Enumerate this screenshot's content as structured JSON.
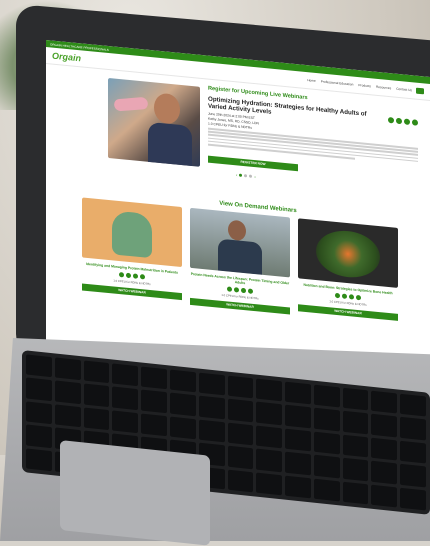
{
  "site": {
    "topbar_text": "ORGAIN HEALTHCARE PROFESSIONALS",
    "logo": "Orgain",
    "nav": [
      "Home",
      "Professional Education",
      "Products",
      "Resources",
      "Contact Us"
    ],
    "brand_color": "#2e8b18"
  },
  "hero": {
    "section_title": "Register for Upcoming Live Webinars",
    "title": "Optimizing Hydration: Strategies for Healthy Adults of Varied Activity Levels",
    "date": "June 20th 2024 at 2:00 PM EST",
    "presenter": "Kathy Jones, MS, RD, CSSD, LDN",
    "credits": "1.0 CPEU for RDNs & NDTRs",
    "button": "REGISTER NOW",
    "carousel_prev": "‹",
    "carousel_next": "›"
  },
  "on_demand": {
    "section_title": "View On Demand Webinars",
    "cards": [
      {
        "title": "Identifying and Managing Protein Malnutrition in Patients",
        "meta": "1.0 CPEU for RDNs & NDTRs",
        "button": "WATCH WEBINAR"
      },
      {
        "title": "Protein Needs Across the Lifespan: Protein Timing and Older Adults",
        "meta": "1.0 CPEU for RDNs & NDTRs",
        "button": "WATCH WEBINAR"
      },
      {
        "title": "Nutrition and Bone: Strategies to Optimize Bone Health",
        "meta": "1.0 CPEU for RDNs & NDTRs",
        "button": "WATCH WEBINAR"
      }
    ]
  }
}
